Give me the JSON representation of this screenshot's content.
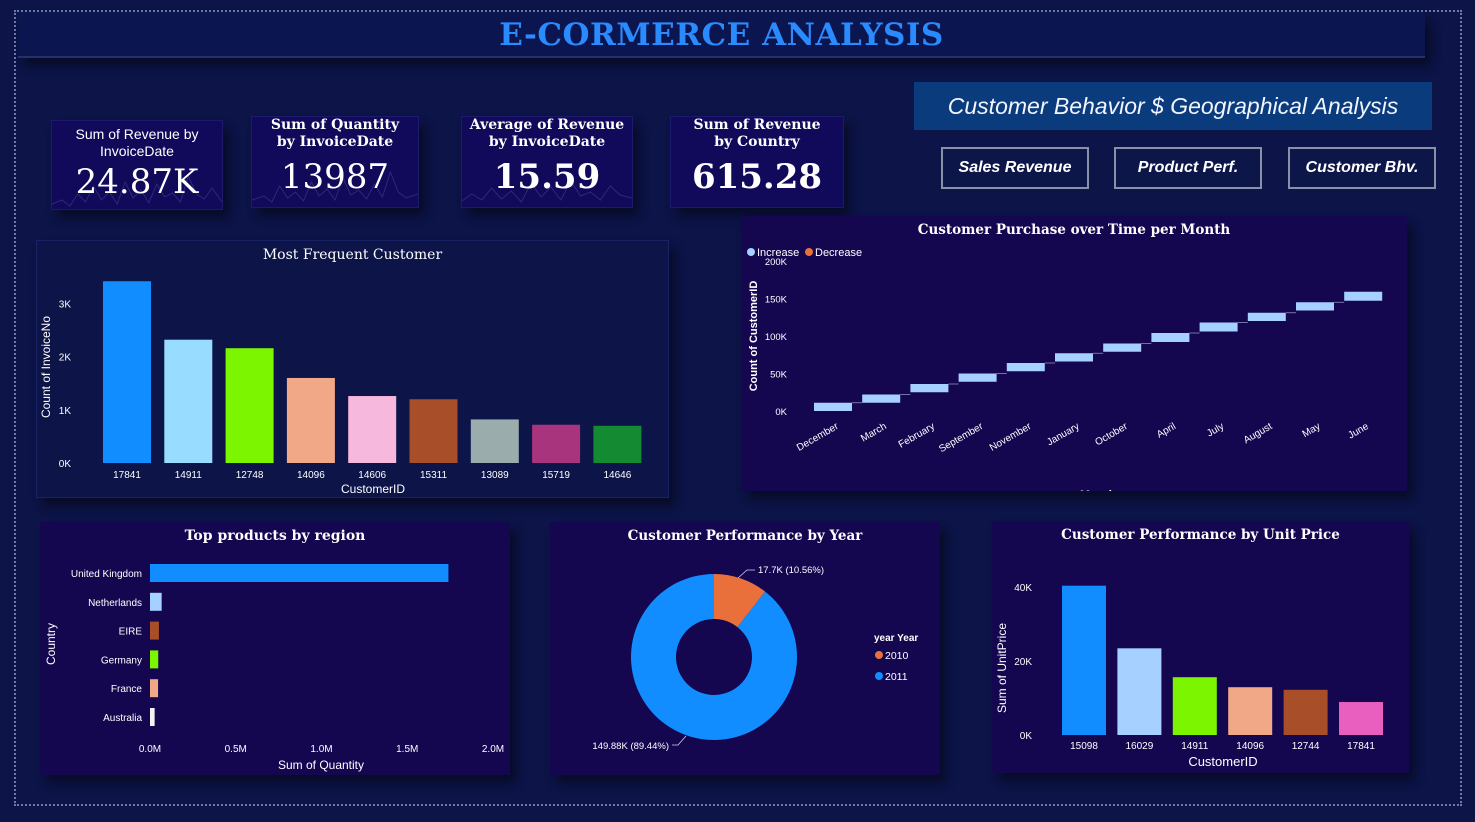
{
  "header": {
    "title": "E-CORMERCE ANALYSIS"
  },
  "subtitle": "Customer Behavior $ Geographical Analysis",
  "nav": [
    {
      "label": "Sales Revenue"
    },
    {
      "label": "Product Perf."
    },
    {
      "label": "Customer Bhv."
    }
  ],
  "kpis": [
    {
      "label": "Sum of Revenue by InvoiceDate",
      "value": "24.87K"
    },
    {
      "label": "Sum of Quantity by InvoiceDate",
      "value": "13987"
    },
    {
      "label": "Average of Revenue by InvoiceDate",
      "value": "15.59"
    },
    {
      "label": "Sum of Revenue by Country",
      "value": "615.28"
    }
  ],
  "chart_data": [
    {
      "id": "frequent",
      "type": "bar",
      "title": "Most Frequent Customer",
      "xlabel": "CustomerID",
      "ylabel": "Count of InvoiceNo",
      "categories": [
        "17841",
        "14911",
        "12748",
        "14096",
        "14606",
        "15311",
        "13089",
        "15719",
        "14646"
      ],
      "values": [
        3420,
        2320,
        2160,
        1600,
        1260,
        1200,
        820,
        720,
        700
      ],
      "colors": [
        "#118dff",
        "#98dcff",
        "#7cf500",
        "#f0a886",
        "#f7b8de",
        "#a84e28",
        "#9aacac",
        "#a7347c",
        "#148a32"
      ],
      "yticks": [
        "0K",
        "1K",
        "2K",
        "3K"
      ],
      "ylim": [
        0,
        3500
      ],
      "grid": false
    },
    {
      "id": "waterfall",
      "type": "bar",
      "subtype": "waterfall",
      "title": "Customer Purchase over Time per Month",
      "xlabel": "Month",
      "ylabel": "Count of CustomerID",
      "legend": [
        {
          "name": "Increase",
          "color": "#a6d0ff"
        },
        {
          "name": "Decrease",
          "color": "#e9703a"
        }
      ],
      "legend_position": "top-left",
      "categories": [
        "December",
        "March",
        "February",
        "September",
        "November",
        "January",
        "October",
        "April",
        "July",
        "August",
        "May",
        "June"
      ],
      "starts": [
        0,
        11000,
        25000,
        39000,
        53000,
        66000,
        79000,
        92000,
        106000,
        120000,
        134000,
        147000
      ],
      "ends": [
        11000,
        22000,
        36000,
        50000,
        64000,
        77000,
        90000,
        104000,
        118000,
        131000,
        145000,
        159000
      ],
      "yticks": [
        "0K",
        "50K",
        "100K",
        "150K",
        "200K"
      ],
      "ylim": [
        0,
        200000
      ]
    },
    {
      "id": "regions",
      "type": "bar",
      "orientation": "horizontal",
      "title": "Top products by region",
      "xlabel": "Sum of Quantity",
      "ylabel": "Country",
      "categories": [
        "United Kingdom",
        "Netherlands",
        "EIRE",
        "Germany",
        "France",
        "Australia"
      ],
      "values": [
        1740000,
        68000,
        52000,
        48000,
        47000,
        27000
      ],
      "colors": [
        "#118dff",
        "#a6d0ff",
        "#a84e28",
        "#7cf500",
        "#f0a886",
        "#f3f3f3"
      ],
      "xticks": [
        "0.0M",
        "0.5M",
        "1.0M",
        "1.5M",
        "2.0M"
      ],
      "xlim": [
        0,
        2000000
      ]
    },
    {
      "id": "years",
      "type": "pie",
      "subtype": "donut",
      "title": "Customer Performance by Year",
      "legend_title": "year Year",
      "legend_position": "right",
      "slices": [
        {
          "name": "2010",
          "value": 17700,
          "label": "17.7K (10.56%)",
          "color": "#e9703a"
        },
        {
          "name": "2011",
          "value": 149880,
          "label": "149.88K (89.44%)",
          "color": "#118dff"
        }
      ]
    },
    {
      "id": "unitprice",
      "type": "bar",
      "title": "Customer Performance by Unit Price",
      "xlabel": "CustomerID",
      "ylabel": "Sum of UnitPrice",
      "categories": [
        "15098",
        "16029",
        "14911",
        "14096",
        "12744",
        "17841"
      ],
      "values": [
        40300,
        23400,
        15600,
        12900,
        12200,
        8900
      ],
      "colors": [
        "#118dff",
        "#a6d0ff",
        "#7cf500",
        "#f0a886",
        "#a84e28",
        "#e85fc0"
      ],
      "yticks": [
        "0K",
        "20K",
        "40K"
      ],
      "ylim": [
        0,
        44000
      ]
    }
  ]
}
